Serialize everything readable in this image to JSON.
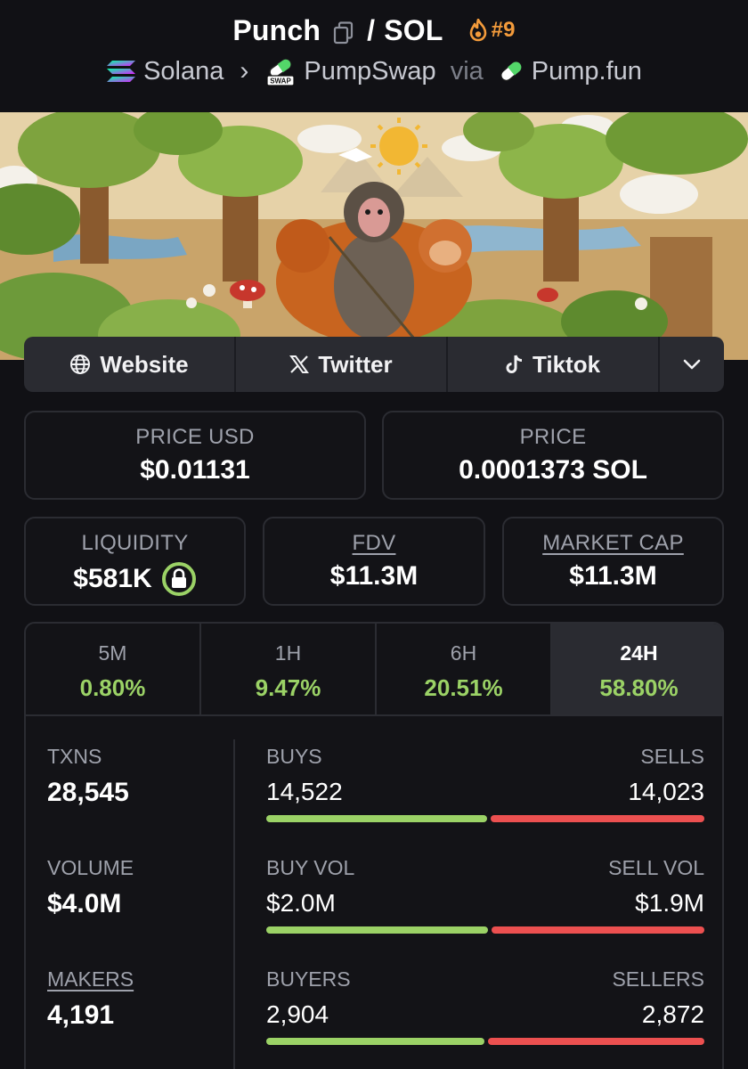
{
  "header": {
    "token": "Punch",
    "slash": "/",
    "quote": "SOL",
    "rank": "#9",
    "chain": "Solana",
    "dex": "PumpSwap",
    "via": "via",
    "launchpad": "Pump.fun",
    "swap_badge": "SWAP"
  },
  "links": {
    "website": "Website",
    "twitter": "Twitter",
    "tiktok": "Tiktok"
  },
  "price": {
    "usd_label": "PRICE USD",
    "usd_value": "$0.01131",
    "native_label": "PRICE",
    "native_value": "0.0001373 SOL"
  },
  "metrics": {
    "liquidity_label": "LIQUIDITY",
    "liquidity_value": "$581K",
    "fdv_label": "FDV",
    "fdv_value": "$11.3M",
    "mcap_label": "MARKET CAP",
    "mcap_value": "$11.3M"
  },
  "timeframes": [
    {
      "label": "5M",
      "value": "0.80%"
    },
    {
      "label": "1H",
      "value": "9.47%"
    },
    {
      "label": "6H",
      "value": "20.51%"
    },
    {
      "label": "24H",
      "value": "58.80%"
    }
  ],
  "stats": {
    "txns_label": "TXNS",
    "txns_value": "28,545",
    "volume_label": "VOLUME",
    "volume_value": "$4.0M",
    "makers_label": "MAKERS",
    "makers_value": "4,191",
    "buys_label": "BUYS",
    "buys_value": "14,522",
    "sells_label": "SELLS",
    "sells_value": "14,023",
    "buys_share": 0.509,
    "buyvol_label": "BUY VOL",
    "buyvol_value": "$2.0M",
    "sellvol_label": "SELL VOL",
    "sellvol_value": "$1.9M",
    "buyvol_share": 0.51,
    "buyers_label": "BUYERS",
    "buyers_value": "2,904",
    "sellers_label": "SELLERS",
    "sellers_value": "2,872",
    "buyers_share": 0.503
  },
  "colors": {
    "positive": "#9bd266",
    "negative": "#ec5050",
    "rank": "#f39b3b"
  }
}
